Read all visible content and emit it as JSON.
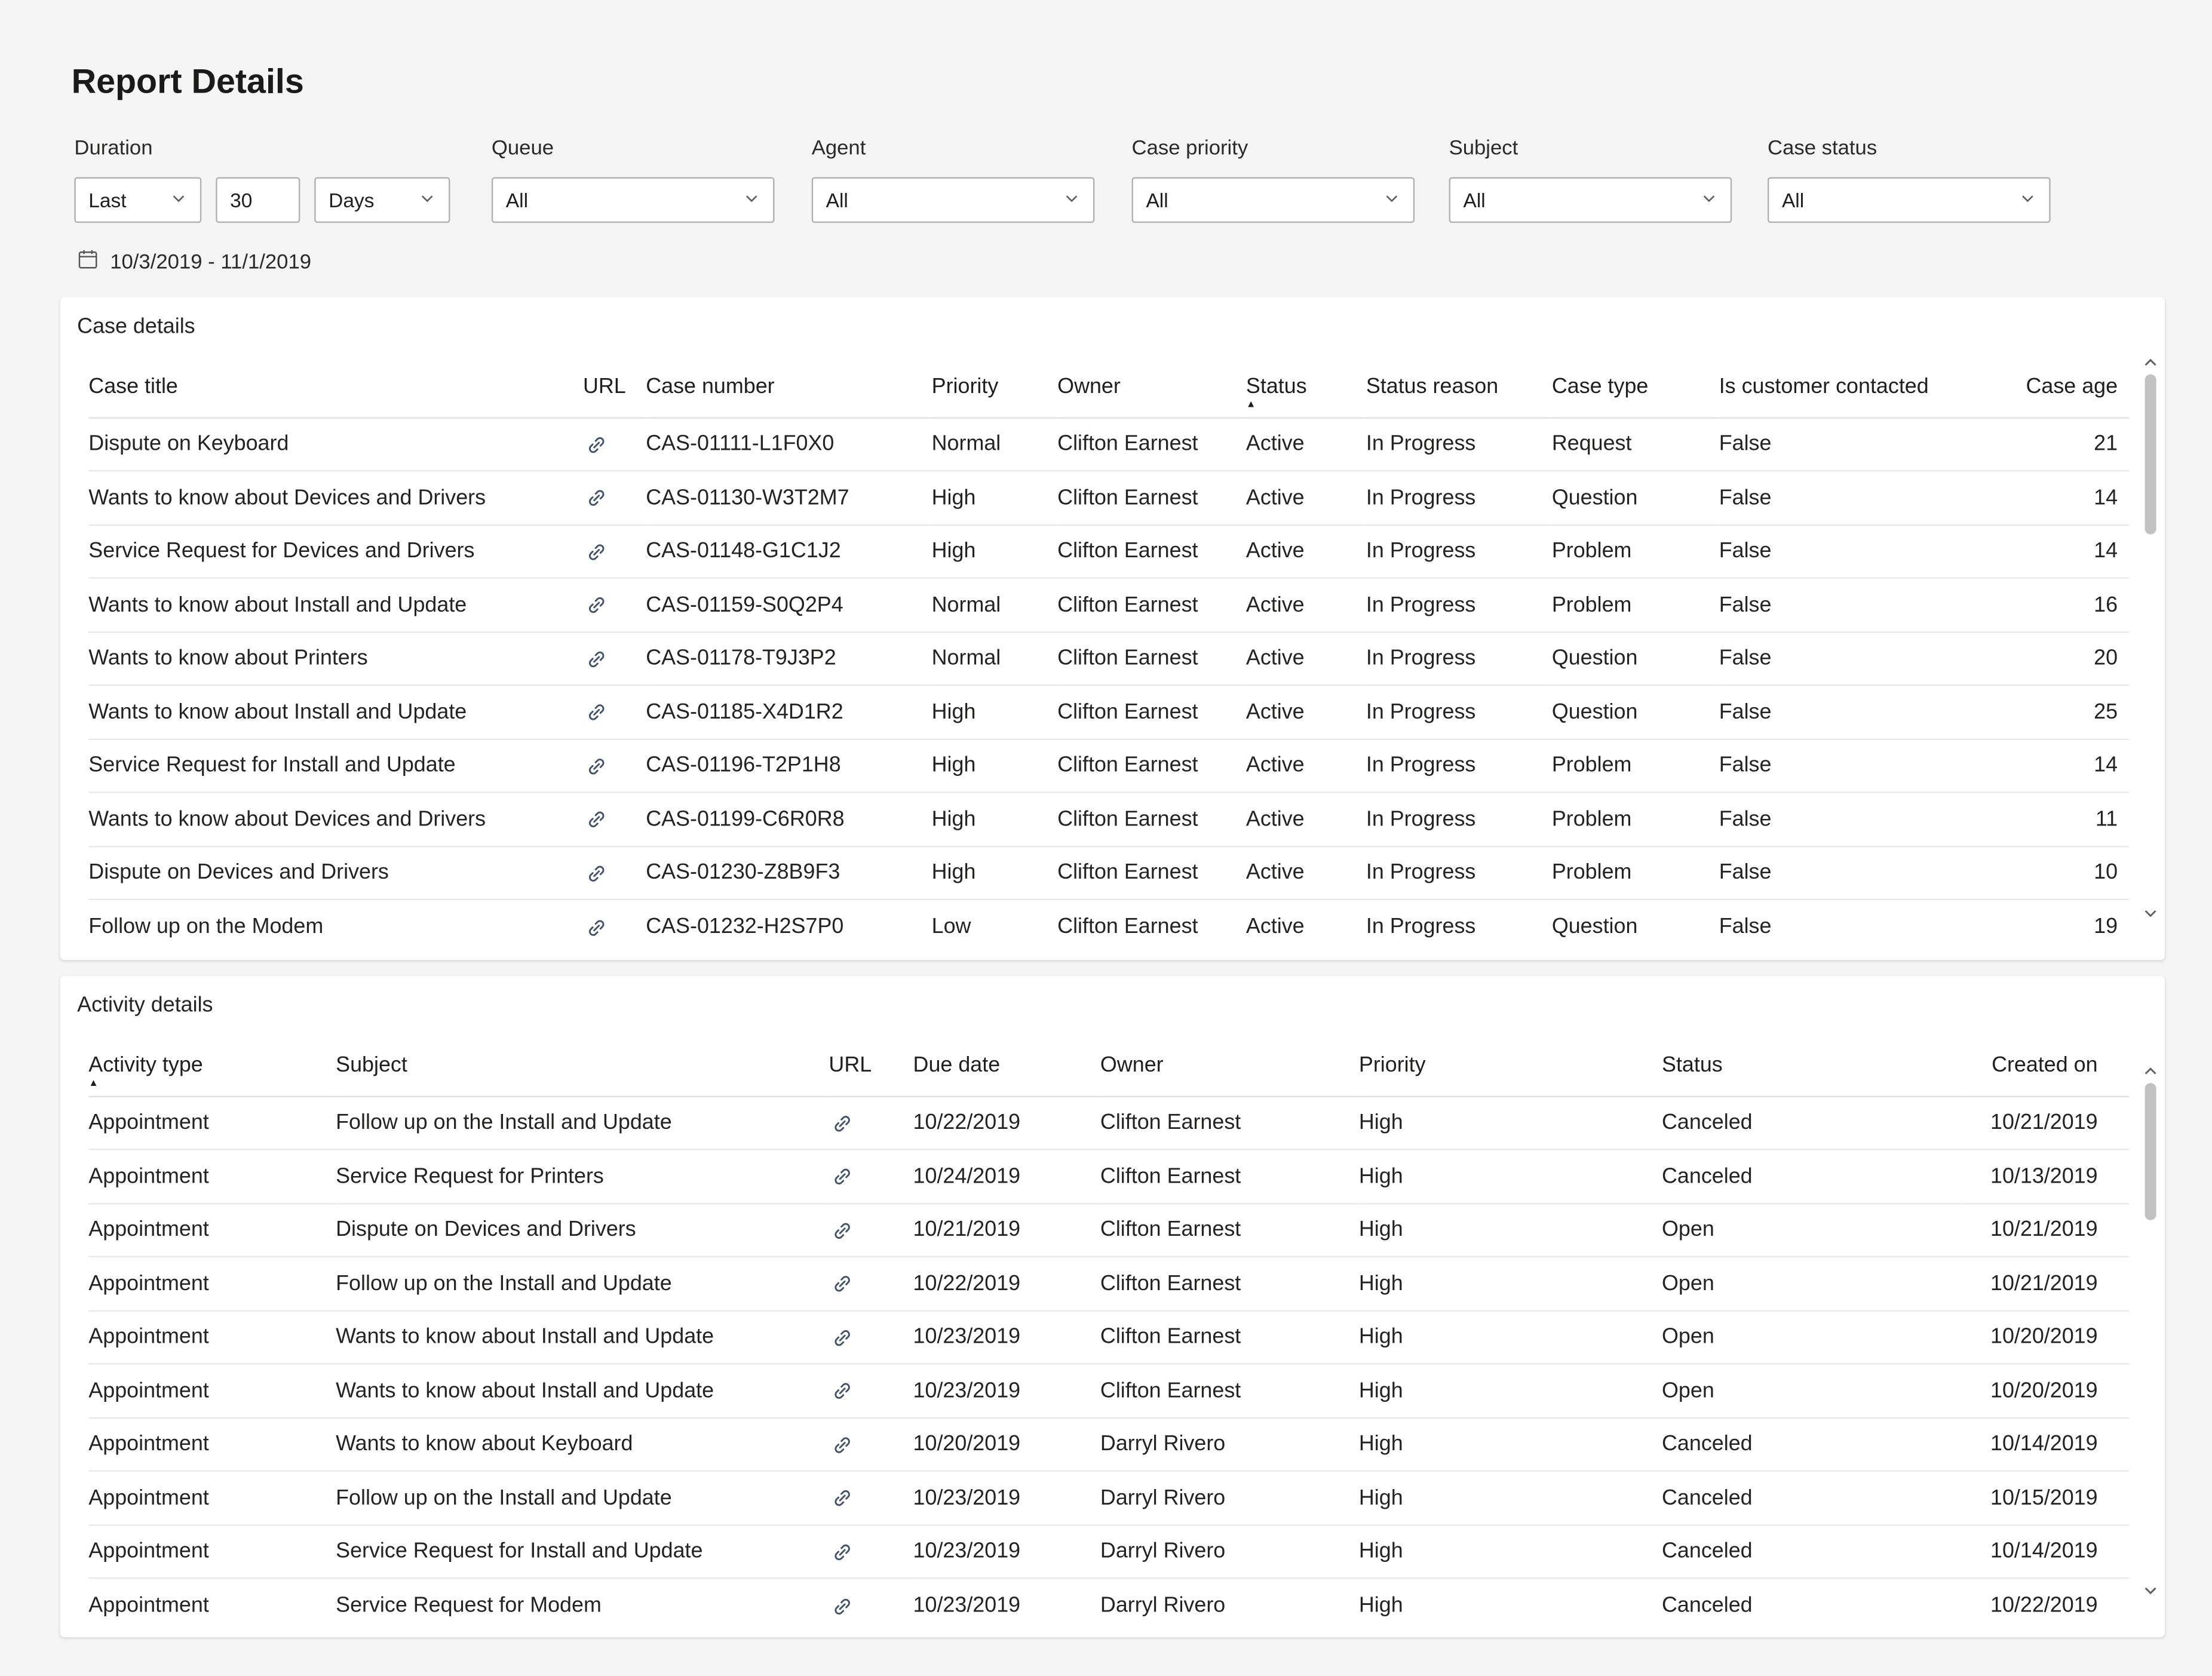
{
  "page": {
    "title": "Report Details"
  },
  "filters": {
    "duration": {
      "label": "Duration",
      "last_value": "Last",
      "amount_value": "30",
      "unit_value": "Days",
      "date_range": "10/3/2019 - 11/1/2019"
    },
    "queue": {
      "label": "Queue",
      "value": "All"
    },
    "agent": {
      "label": "Agent",
      "value": "All"
    },
    "case_priority": {
      "label": "Case priority",
      "value": "All"
    },
    "subject": {
      "label": "Subject",
      "value": "All"
    },
    "case_status": {
      "label": "Case status",
      "value": "All"
    }
  },
  "case_details": {
    "title": "Case details",
    "columns": [
      "Case title",
      "URL",
      "Case number",
      "Priority",
      "Owner",
      "Status",
      "Status reason",
      "Case type",
      "Is customer contacted",
      "Case age"
    ],
    "sort": {
      "column": "Status",
      "direction": "asc"
    },
    "rows": [
      {
        "title": "Dispute on Keyboard",
        "case_number": "CAS-01111-L1F0X0",
        "priority": "Normal",
        "owner": "Clifton Earnest",
        "status": "Active",
        "status_reason": "In Progress",
        "case_type": "Request",
        "is_customer_contacted": "False",
        "case_age": "21"
      },
      {
        "title": "Wants to know about Devices and Drivers",
        "case_number": "CAS-01130-W3T2M7",
        "priority": "High",
        "owner": "Clifton Earnest",
        "status": "Active",
        "status_reason": "In Progress",
        "case_type": "Question",
        "is_customer_contacted": "False",
        "case_age": "14"
      },
      {
        "title": "Service Request for Devices and Drivers",
        "case_number": "CAS-01148-G1C1J2",
        "priority": "High",
        "owner": "Clifton Earnest",
        "status": "Active",
        "status_reason": "In Progress",
        "case_type": "Problem",
        "is_customer_contacted": "False",
        "case_age": "14"
      },
      {
        "title": "Wants to know about Install and Update",
        "case_number": "CAS-01159-S0Q2P4",
        "priority": "Normal",
        "owner": "Clifton Earnest",
        "status": "Active",
        "status_reason": "In Progress",
        "case_type": "Problem",
        "is_customer_contacted": "False",
        "case_age": "16"
      },
      {
        "title": "Wants to know about Printers",
        "case_number": "CAS-01178-T9J3P2",
        "priority": "Normal",
        "owner": "Clifton Earnest",
        "status": "Active",
        "status_reason": "In Progress",
        "case_type": "Question",
        "is_customer_contacted": "False",
        "case_age": "20"
      },
      {
        "title": "Wants to know about Install and Update",
        "case_number": "CAS-01185-X4D1R2",
        "priority": "High",
        "owner": "Clifton Earnest",
        "status": "Active",
        "status_reason": "In Progress",
        "case_type": "Question",
        "is_customer_contacted": "False",
        "case_age": "25"
      },
      {
        "title": "Service Request for Install and Update",
        "case_number": "CAS-01196-T2P1H8",
        "priority": "High",
        "owner": "Clifton Earnest",
        "status": "Active",
        "status_reason": "In Progress",
        "case_type": "Problem",
        "is_customer_contacted": "False",
        "case_age": "14"
      },
      {
        "title": "Wants to know about Devices and Drivers",
        "case_number": "CAS-01199-C6R0R8",
        "priority": "High",
        "owner": "Clifton Earnest",
        "status": "Active",
        "status_reason": "In Progress",
        "case_type": "Problem",
        "is_customer_contacted": "False",
        "case_age": "11"
      },
      {
        "title": "Dispute on Devices and Drivers",
        "case_number": "CAS-01230-Z8B9F3",
        "priority": "High",
        "owner": "Clifton Earnest",
        "status": "Active",
        "status_reason": "In Progress",
        "case_type": "Problem",
        "is_customer_contacted": "False",
        "case_age": "10"
      },
      {
        "title": "Follow up on the  Modem",
        "case_number": "CAS-01232-H2S7P0",
        "priority": "Low",
        "owner": "Clifton Earnest",
        "status": "Active",
        "status_reason": "In Progress",
        "case_type": "Question",
        "is_customer_contacted": "False",
        "case_age": "19"
      }
    ]
  },
  "activity_details": {
    "title": "Activity details",
    "columns": [
      "Activity type",
      "Subject",
      "URL",
      "Due date",
      "Owner",
      "Priority",
      "Status",
      "Created on"
    ],
    "sort": {
      "column": "Activity type",
      "direction": "asc"
    },
    "rows": [
      {
        "activity_type": "Appointment",
        "subject": "Follow up on the Install and Update",
        "due_date": "10/22/2019",
        "owner": "Clifton Earnest",
        "priority": "High",
        "status": "Canceled",
        "created_on": "10/21/2019"
      },
      {
        "activity_type": "Appointment",
        "subject": "Service Request for Printers",
        "due_date": "10/24/2019",
        "owner": "Clifton Earnest",
        "priority": "High",
        "status": "Canceled",
        "created_on": "10/13/2019"
      },
      {
        "activity_type": "Appointment",
        "subject": "Dispute on Devices and Drivers",
        "due_date": "10/21/2019",
        "owner": "Clifton Earnest",
        "priority": "High",
        "status": "Open",
        "created_on": "10/21/2019"
      },
      {
        "activity_type": "Appointment",
        "subject": "Follow up on the Install and Update",
        "due_date": "10/22/2019",
        "owner": "Clifton Earnest",
        "priority": "High",
        "status": "Open",
        "created_on": "10/21/2019"
      },
      {
        "activity_type": "Appointment",
        "subject": "Wants to know about Install and Update",
        "due_date": "10/23/2019",
        "owner": "Clifton Earnest",
        "priority": "High",
        "status": "Open",
        "created_on": "10/20/2019"
      },
      {
        "activity_type": "Appointment",
        "subject": "Wants to know about Install and Update",
        "due_date": "10/23/2019",
        "owner": "Clifton Earnest",
        "priority": "High",
        "status": "Open",
        "created_on": "10/20/2019"
      },
      {
        "activity_type": "Appointment",
        "subject": "Wants to know about Keyboard",
        "due_date": "10/20/2019",
        "owner": "Darryl Rivero",
        "priority": "High",
        "status": "Canceled",
        "created_on": "10/14/2019"
      },
      {
        "activity_type": "Appointment",
        "subject": "Follow up on the Install and Update",
        "due_date": "10/23/2019",
        "owner": "Darryl Rivero",
        "priority": "High",
        "status": "Canceled",
        "created_on": "10/15/2019"
      },
      {
        "activity_type": "Appointment",
        "subject": "Service Request for Install and Update",
        "due_date": "10/23/2019",
        "owner": "Darryl Rivero",
        "priority": "High",
        "status": "Canceled",
        "created_on": "10/14/2019"
      },
      {
        "activity_type": "Appointment",
        "subject": "Service Request for Modem",
        "due_date": "10/23/2019",
        "owner": "Darryl Rivero",
        "priority": "High",
        "status": "Canceled",
        "created_on": "10/22/2019"
      }
    ]
  },
  "colors": {
    "page_background": "#f5f5f5",
    "card_background": "#ffffff",
    "link_icon": "#44536a",
    "text": "#252423"
  }
}
